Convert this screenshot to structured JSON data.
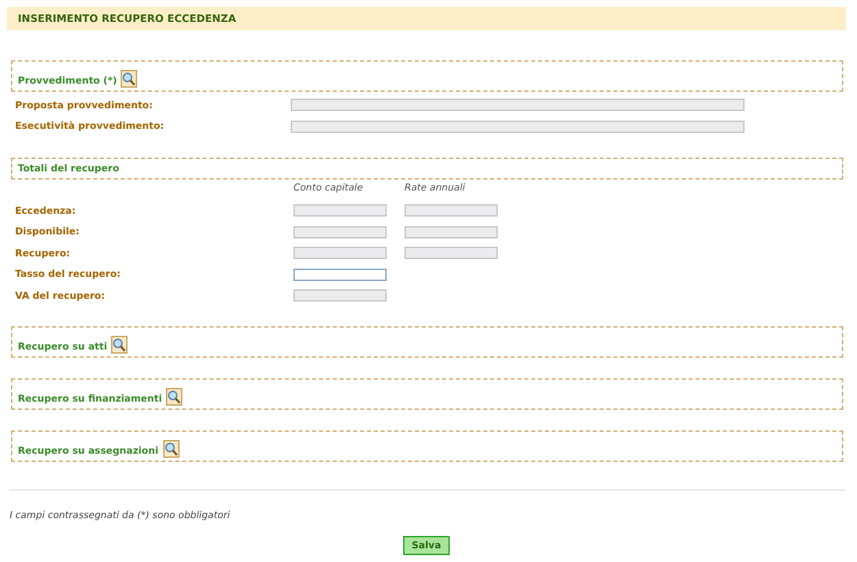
{
  "title": "INSERIMENTO RECUPERO ECCEDENZA",
  "provvedimento": {
    "legend": "Provvedimento (*)",
    "rows": [
      {
        "label": "Proposta provvedimento:",
        "disabled": true
      },
      {
        "label": "Esecutività provvedimento:",
        "disabled": true
      }
    ]
  },
  "totali": {
    "legend": "Totali del recupero",
    "columns": [
      "Conto capitale",
      "Rate annuali"
    ],
    "rows": [
      {
        "label": "Eccedenza:",
        "fields": [
          {
            "disabled": true
          },
          {
            "disabled": true
          }
        ]
      },
      {
        "label": "Disponibile:",
        "fields": [
          {
            "disabled": true
          },
          {
            "disabled": true
          }
        ]
      },
      {
        "label": "Recupero:",
        "fields": [
          {
            "disabled": true
          },
          {
            "disabled": true
          }
        ]
      },
      {
        "label": "Tasso del recupero:",
        "fields": [
          {
            "disabled": false
          }
        ]
      },
      {
        "label": "VA del recupero:",
        "fields": [
          {
            "disabled": true
          }
        ]
      }
    ]
  },
  "sections": [
    "Recupero su atti",
    "Recupero su finanziamenti",
    "Recupero su assegnazioni"
  ],
  "note": "I campi contrassegnati da (*) sono obbligatori",
  "save_button": "Salva"
}
